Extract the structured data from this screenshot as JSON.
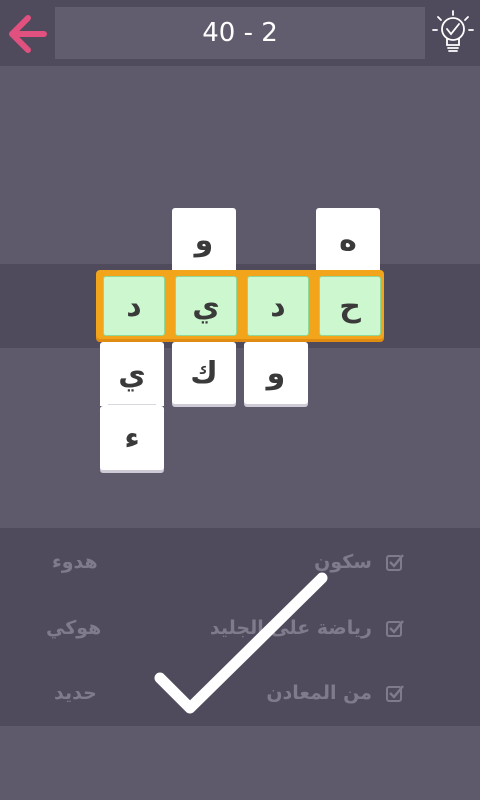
{
  "header": {
    "level": "40 - 2"
  },
  "grid": {
    "tiles_top": [
      "و",
      "ه"
    ],
    "word": [
      "ح",
      "د",
      "ي",
      "د"
    ],
    "tiles_below": [
      "ي",
      "ء",
      "ك",
      "و"
    ]
  },
  "clues": [
    {
      "text": "سكون",
      "answer": "هدوء"
    },
    {
      "text": "رياضة على الجليد",
      "answer": "هوكي"
    },
    {
      "text": "من المعادن",
      "answer": "حديد"
    }
  ],
  "colors": {
    "background": "#5e5a6c",
    "bar": "#4f4b5c",
    "back_arrow": "#e0517f",
    "word_frame": "#f2a51a",
    "solved_tile": "#cdf7cf"
  },
  "icons": {
    "back": "back-arrow-icon",
    "hint": "lightbulb-check-icon",
    "clue_check": "checkbox-check-icon",
    "overlay": "big-check-icon"
  }
}
